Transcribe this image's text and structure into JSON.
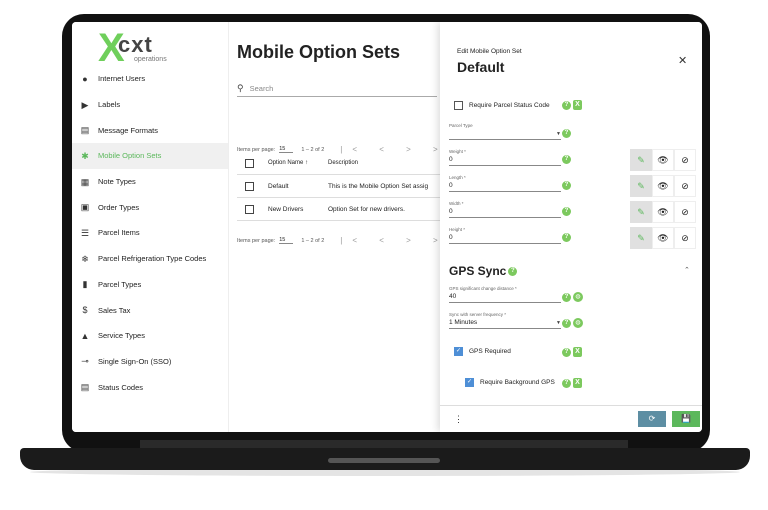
{
  "brand": {
    "logo_x": "X",
    "logo_name": "cxt",
    "logo_sub": "operations"
  },
  "sidebar": {
    "items": [
      {
        "label": "Internet Users",
        "icon": "user-circle-icon",
        "glyph": "●"
      },
      {
        "label": "Labels",
        "icon": "label-icon",
        "glyph": "▶"
      },
      {
        "label": "Message Formats",
        "icon": "message-icon",
        "glyph": "▤"
      },
      {
        "label": "Mobile Option Sets",
        "icon": "gear-icon",
        "glyph": "✱",
        "active": true
      },
      {
        "label": "Note Types",
        "icon": "note-icon",
        "glyph": "▦"
      },
      {
        "label": "Order Types",
        "icon": "clipboard-icon",
        "glyph": "▣"
      },
      {
        "label": "Parcel Items",
        "icon": "list-icon",
        "glyph": "☰"
      },
      {
        "label": "Parcel Refrigeration Type Codes",
        "icon": "snowflake-icon",
        "glyph": "❄"
      },
      {
        "label": "Parcel Types",
        "icon": "building-icon",
        "glyph": "▮"
      },
      {
        "label": "Sales Tax",
        "icon": "dollar-icon",
        "glyph": "$"
      },
      {
        "label": "Service Types",
        "icon": "car-icon",
        "glyph": "▲"
      },
      {
        "label": "Single Sign-On (SSO)",
        "icon": "key-icon",
        "glyph": "⊸"
      },
      {
        "label": "Status Codes",
        "icon": "document-icon",
        "glyph": "▤"
      }
    ]
  },
  "main": {
    "title": "Mobile Option Sets",
    "search_placeholder": "Search",
    "pager_top": {
      "label": "Items per page:",
      "value": "15",
      "range": "1 – 2 of 2",
      "nav": "|< < > >|"
    },
    "pager_bottom": {
      "label": "Items per page:",
      "value": "15",
      "range": "1 – 2 of 2",
      "nav": "|< < > >|"
    },
    "table": {
      "headers": [
        "Option Name ↑",
        "Description"
      ],
      "rows": [
        {
          "name": "Default",
          "description": "This is the Mobile Option Set assig"
        },
        {
          "name": "New Drivers",
          "description": "Option Set for new drivers."
        }
      ]
    }
  },
  "drawer": {
    "subtitle": "Edit Mobile Option Set",
    "title": "Default",
    "close": "✕",
    "require_status_label": "Require Parcel Status Code",
    "parcel_type": {
      "label": "Parcel Type",
      "value": ""
    },
    "weight": {
      "label": "Weight *",
      "value": "0"
    },
    "length": {
      "label": "Length *",
      "value": "0"
    },
    "width": {
      "label": "Width *",
      "value": "0"
    },
    "height": {
      "label": "Height *",
      "value": "0"
    },
    "gps_title": "GPS Sync",
    "gps_distance": {
      "label": "GPS significant change distance *",
      "value": "40"
    },
    "gps_frequency": {
      "label": "Sync with server frequency *",
      "value": "1 Minutes"
    },
    "gps_required_label": "GPS Required",
    "background_gps_label": "Require Background GPS",
    "help": "?",
    "x_badge": "X",
    "menu": "⋮",
    "reset": "⟳",
    "save": "💾",
    "edit_glyph": "✎",
    "view_glyph": "👁",
    "hide_glyph": "⊘",
    "collapse_glyph": "⌃",
    "globe": "◍"
  },
  "colors": {
    "accent": "#5cb85c",
    "help": "#7cc95e",
    "reset_btn": "#5d8ea3",
    "checkbox": "#4e8fd6"
  }
}
